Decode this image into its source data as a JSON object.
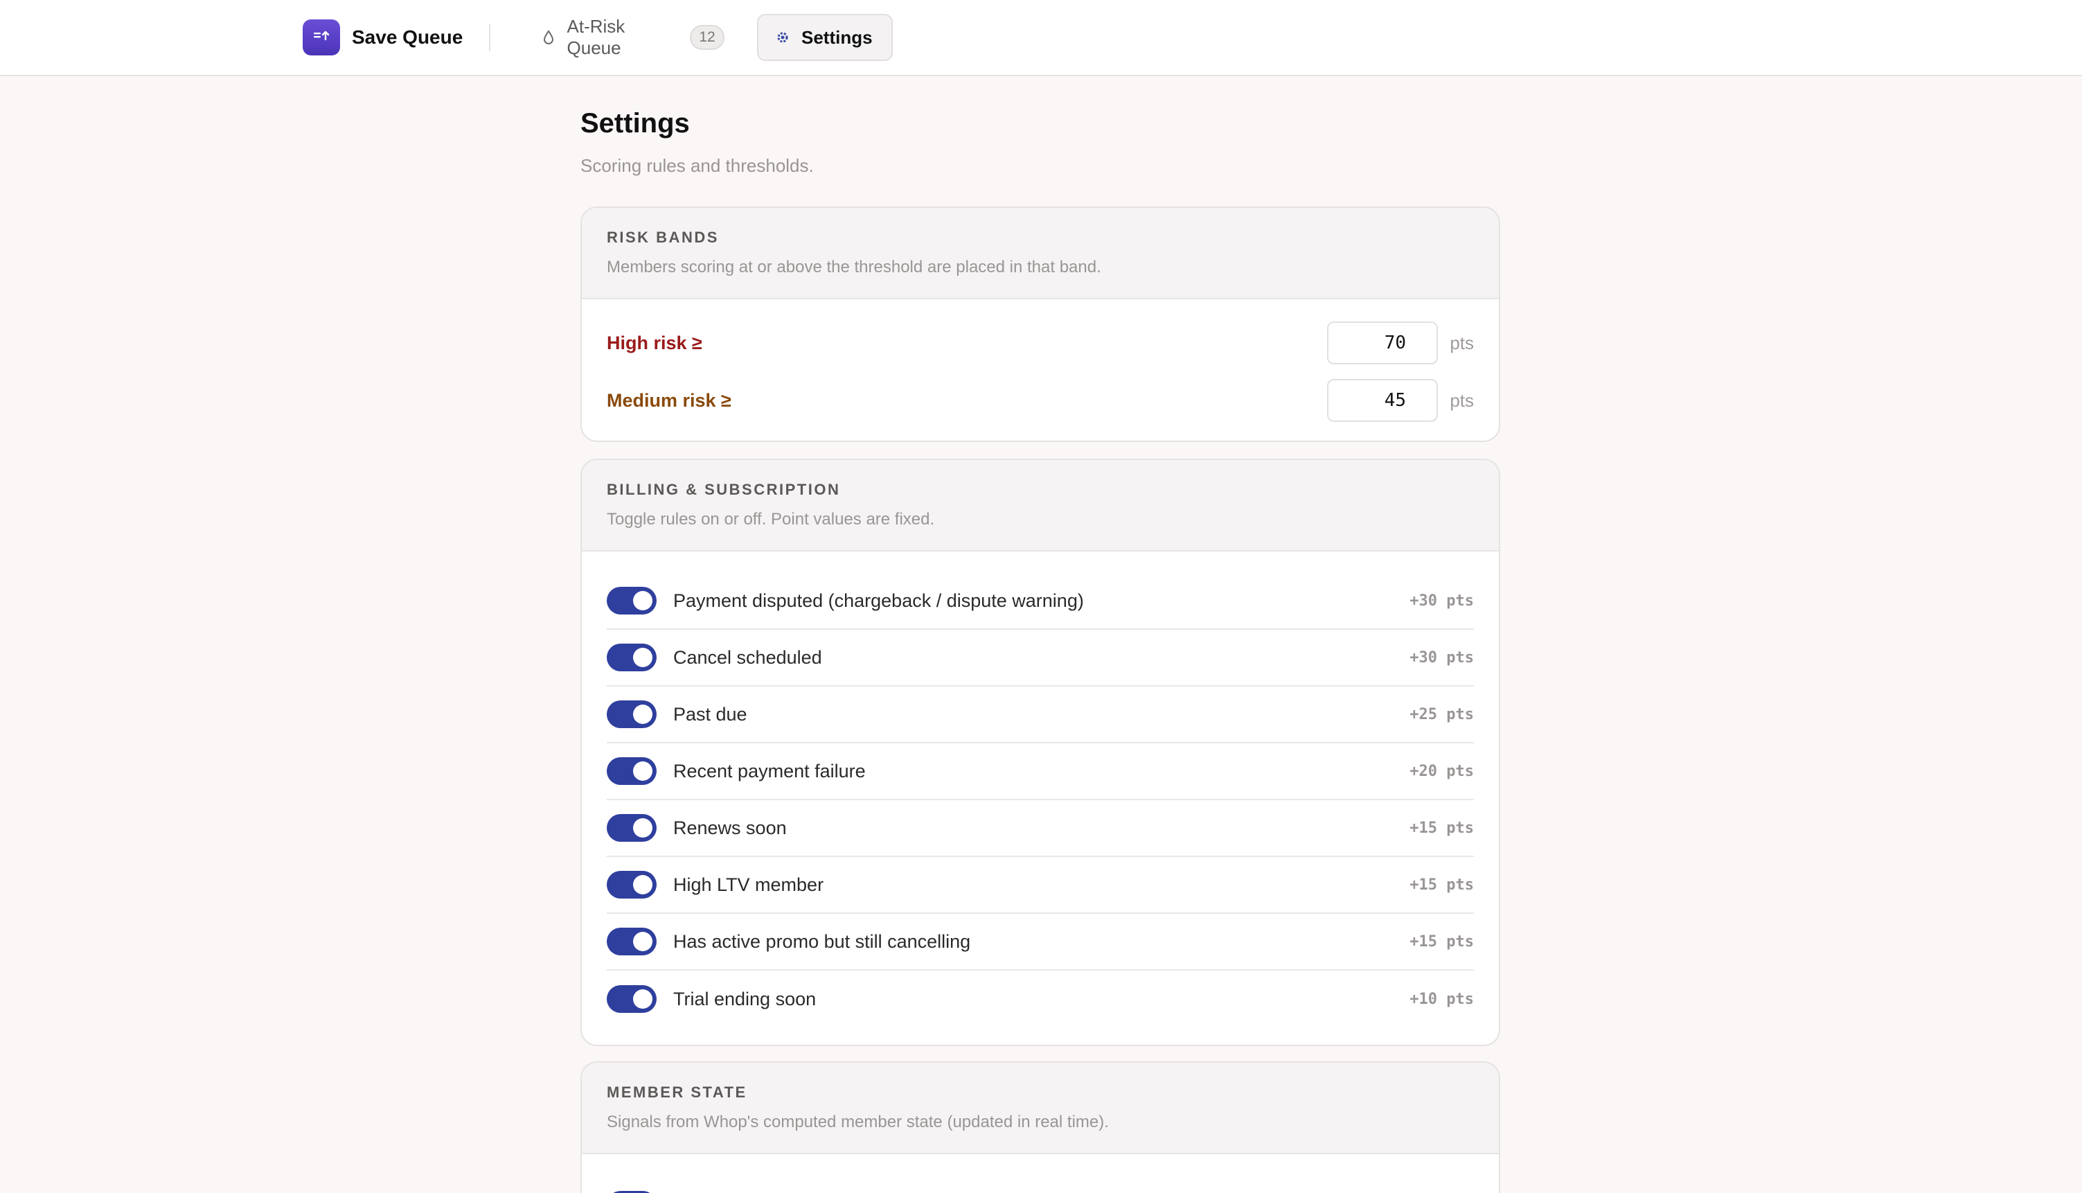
{
  "app": {
    "brand": "Save Queue",
    "icons": {
      "logo": "queue-logo-icon",
      "queue": "droplet-icon",
      "settings": "gear-icon"
    },
    "accent_color": "#2f3f9e",
    "brand_gradient": [
      "#6a4fd6",
      "#4b33b8"
    ]
  },
  "nav": {
    "queue_label": "At-Risk Queue",
    "queue_count": "12",
    "settings_label": "Settings",
    "active": "Settings"
  },
  "page": {
    "title": "Settings",
    "subtitle": "Scoring rules and thresholds."
  },
  "risk_bands": {
    "title": "RISK BANDS",
    "description": "Members scoring at or above the threshold are placed in that band.",
    "high": {
      "label": "High risk ≥",
      "value": "70",
      "unit": "pts",
      "color": "#9a1b1b"
    },
    "medium": {
      "label": "Medium risk ≥",
      "value": "45",
      "unit": "pts",
      "color": "#8a4a0c"
    }
  },
  "billing": {
    "title": "BILLING & SUBSCRIPTION",
    "description": "Toggle rules on or off. Point values are fixed.",
    "rules": [
      {
        "label": "Payment disputed (chargeback / dispute warning)",
        "points": "+30 pts",
        "enabled": true
      },
      {
        "label": "Cancel scheduled",
        "points": "+30 pts",
        "enabled": true
      },
      {
        "label": "Past due",
        "points": "+25 pts",
        "enabled": true
      },
      {
        "label": "Recent payment failure",
        "points": "+20 pts",
        "enabled": true
      },
      {
        "label": "Renews soon",
        "points": "+15 pts",
        "enabled": true
      },
      {
        "label": "High LTV member",
        "points": "+15 pts",
        "enabled": true
      },
      {
        "label": "Has active promo but still cancelling",
        "points": "+15 pts",
        "enabled": true
      },
      {
        "label": "Trial ending soon",
        "points": "+10 pts",
        "enabled": true
      }
    ]
  },
  "member_state": {
    "title": "MEMBER STATE",
    "description": "Signals from Whop's computed member state (updated in real time)."
  }
}
